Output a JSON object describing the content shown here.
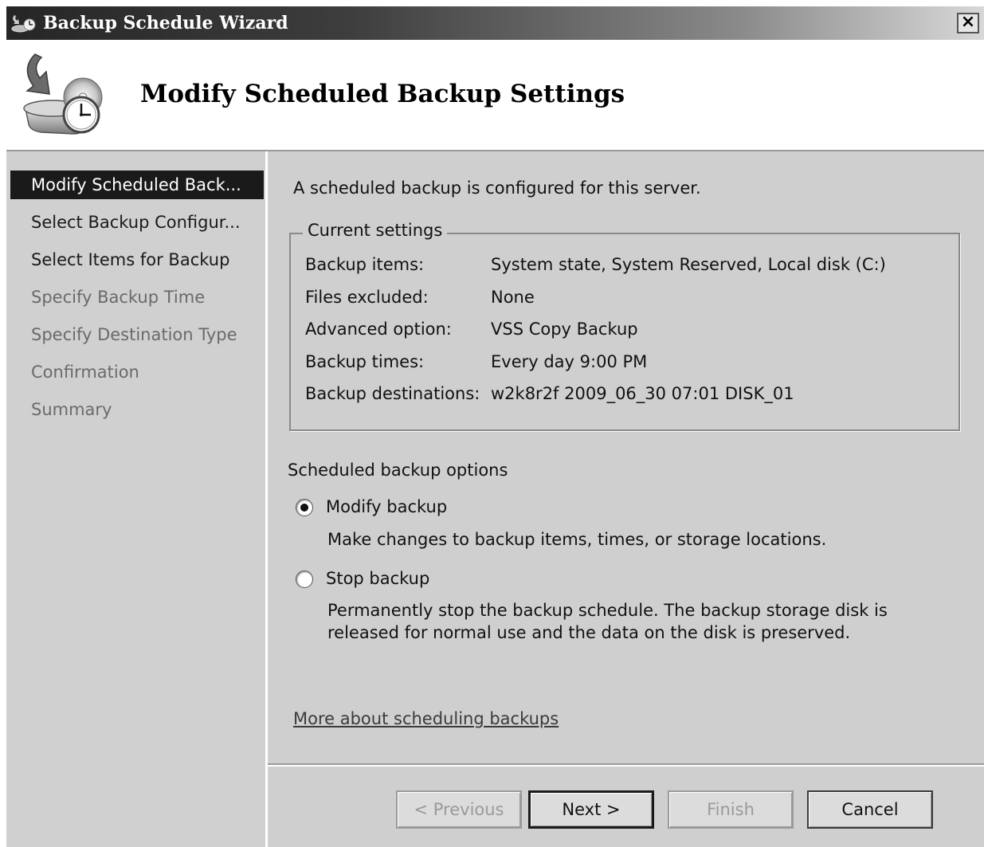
{
  "window": {
    "title": "Backup Schedule Wizard",
    "close_label": "×"
  },
  "header": {
    "title": "Modify Scheduled Backup Settings",
    "icon": "backup-schedule-icon"
  },
  "nav": {
    "items": [
      {
        "label": "Modify Scheduled Back...",
        "state": "active"
      },
      {
        "label": "Select Backup Configur...",
        "state": "enabled"
      },
      {
        "label": "Select Items for Backup",
        "state": "enabled"
      },
      {
        "label": "Specify Backup Time",
        "state": "disabled"
      },
      {
        "label": "Specify Destination Type",
        "state": "disabled"
      },
      {
        "label": "Confirmation",
        "state": "disabled"
      },
      {
        "label": "Summary",
        "state": "disabled"
      }
    ]
  },
  "main": {
    "intro": "A scheduled backup is configured for this server.",
    "current_settings": {
      "legend": "Current settings",
      "rows": [
        {
          "key": "Backup items:",
          "value": "System state, System Reserved, Local disk (C:)"
        },
        {
          "key": "Files excluded:",
          "value": "None"
        },
        {
          "key": "Advanced option:",
          "value": "VSS Copy Backup"
        },
        {
          "key": "Backup times:",
          "value": "Every day 9:00 PM"
        },
        {
          "key": "Backup destinations:",
          "value": "w2k8r2f 2009_06_30 07:01 DISK_01"
        }
      ]
    },
    "options": {
      "label": "Scheduled backup options",
      "modify": {
        "label": "Modify backup",
        "description": "Make changes to backup items, times, or storage locations.",
        "selected": true
      },
      "stop": {
        "label": "Stop backup",
        "description": "Permanently stop the backup schedule. The backup storage disk is released for normal use and the data on the disk is preserved.",
        "selected": false
      }
    },
    "help_link": "More about scheduling backups"
  },
  "buttons": {
    "previous": "< Previous",
    "next": "Next >",
    "finish": "Finish",
    "cancel": "Cancel"
  }
}
